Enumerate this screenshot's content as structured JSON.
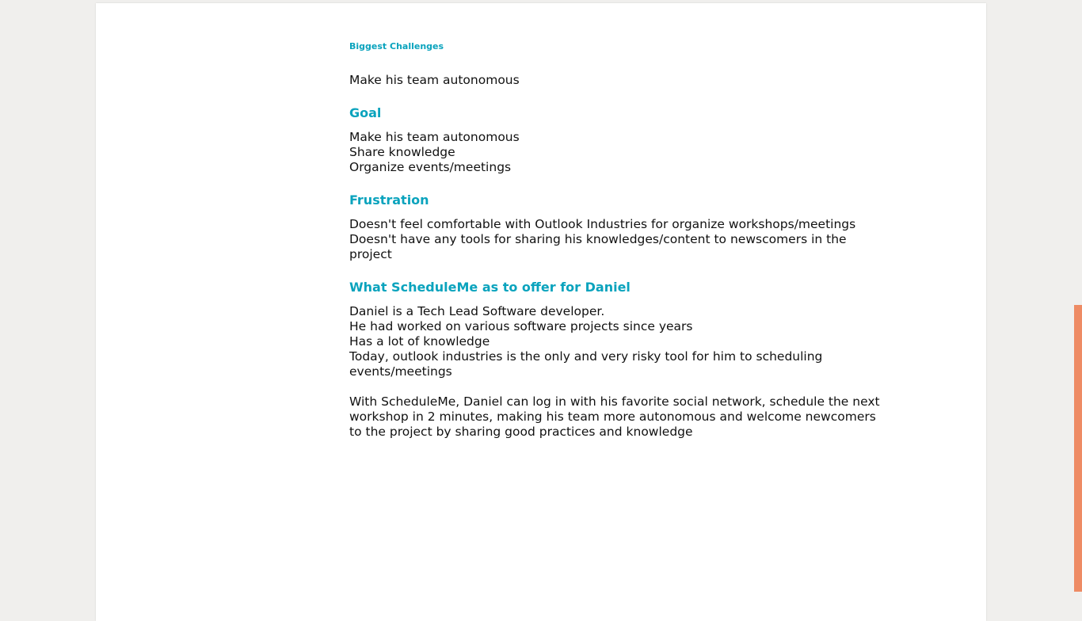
{
  "document": {
    "small_heading": "Biggest Challenges",
    "challenges_text": "Make his team autonomous",
    "goal": {
      "heading": "Goal",
      "lines": [
        "Make his team autonomous",
        "Share knowledge",
        "Organize events/meetings"
      ]
    },
    "frustration": {
      "heading": "Frustration",
      "lines": [
        "Doesn't feel comfortable with Outlook Industries for organize workshops/meetings",
        "Doesn't have any tools for sharing his knowledges/content to newscomers in the",
        "project"
      ]
    },
    "offer": {
      "heading": "What ScheduleMe as to offer for Daniel",
      "lines": [
        "Daniel is a Tech Lead Software developer.",
        "He had worked on various software projects since years",
        "Has a lot of knowledge",
        "Today, outlook industries is the only and very risky tool for him to scheduling",
        "events/meetings"
      ],
      "closing_lines": [
        "With ScheduleMe, Daniel can log in with his favorite social network, schedule the next",
        "workshop in 2 minutes, making his team more autonomous and welcome newcomers",
        "to the project by sharing good practices and knowledge"
      ]
    }
  },
  "colors": {
    "heading": "#0aa3bd",
    "text": "#111111",
    "background": "#f0efed",
    "page": "#ffffff",
    "scrollbar": "#ee8b64"
  }
}
